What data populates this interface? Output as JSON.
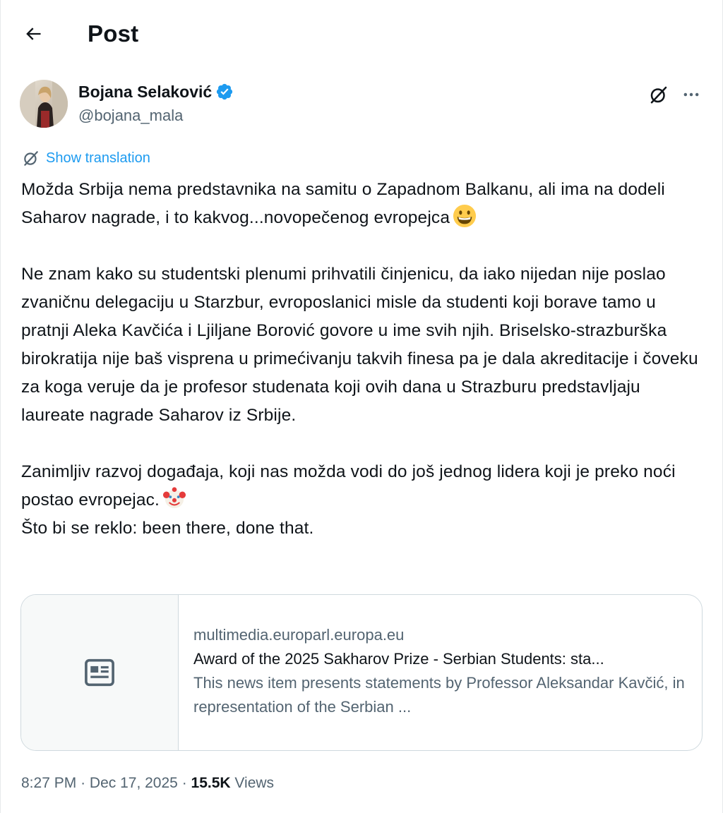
{
  "header": {
    "title": "Post"
  },
  "author": {
    "name": "Bojana Selaković",
    "handle": "@bojana_mala",
    "verified": true
  },
  "translation": {
    "label": "Show translation"
  },
  "body": {
    "paragraph1": "Možda Srbija nema predstavnika na samitu o Zapadnom Balkanu, ali ima na dodeli Saharov nagrade, i to kakvog...novopečenog evropejca",
    "paragraph1_emoji": "grinning-face-emoji",
    "paragraph2": "Ne znam kako su studentski plenumi prihvatili činjenicu, da iako nijedan nije poslao zvaničnu delegaciju u Starzbur, evroposlanici misle da studenti koji borave tamo u pratnji Aleka Kavčića i Ljiljane Borović govore u ime svih njih. Briselsko-strazburška birokratija nije baš visprena u primećivanju takvih finesa pa je dala akreditacije i čoveku za koga veruje da je profesor studenata koji ovih dana u Strazburu predstavljaju laureate nagrade Saharov iz Srbije.",
    "paragraph3_line1": "Zanimljiv razvoj događaja, koji nas možda vodi do još jednog lidera koji je preko noći postao evropejac.",
    "paragraph3_emoji": "clown-face-emoji",
    "paragraph3_line2": "Što bi se reklo: been there, done that."
  },
  "link_card": {
    "domain": "multimedia.europarl.europa.eu",
    "title": "Award of the 2025 Sakharov Prize - Serbian Students: sta...",
    "description": "This news item presents statements by Professor Aleksandar Kavčić, in representation of the Serbian ...",
    "thumbnail_icon": "article-icon"
  },
  "meta": {
    "time": "8:27 PM",
    "separator": "·",
    "date": "Dec 17, 2025",
    "views_count": "15.5K",
    "views_label": "Views"
  },
  "colors": {
    "accent": "#1d9bf0",
    "text_primary": "#0f1419",
    "text_secondary": "#536471",
    "border": "#cfd9de"
  }
}
